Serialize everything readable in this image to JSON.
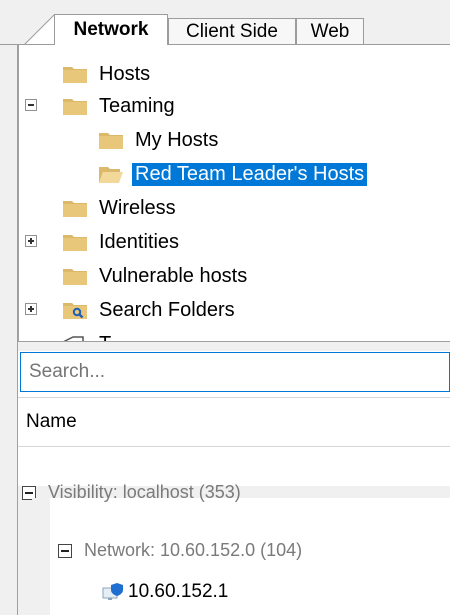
{
  "tabs": [
    {
      "label": "Network",
      "active": true
    },
    {
      "label": "Client Side",
      "active": false
    },
    {
      "label": "Web",
      "active": false
    }
  ],
  "tree": {
    "items": [
      {
        "label": "Hosts",
        "expander": "none",
        "level": 0,
        "icon": "folder-icon"
      },
      {
        "label": "Teaming",
        "expander": "minus",
        "level": 0,
        "icon": "folder-icon"
      },
      {
        "label": "My Hosts",
        "expander": "none",
        "level": 1,
        "icon": "folder-icon"
      },
      {
        "label": "Red Team Leader's Hosts",
        "expander": "none",
        "level": 1,
        "icon": "folder-open-icon",
        "selected": true
      },
      {
        "label": "Wireless",
        "expander": "none",
        "level": 0,
        "icon": "folder-icon"
      },
      {
        "label": "Identities",
        "expander": "plus",
        "level": 0,
        "icon": "folder-icon"
      },
      {
        "label": "Vulnerable hosts",
        "expander": "none",
        "level": 0,
        "icon": "folder-icon"
      },
      {
        "label": "Search Folders",
        "expander": "plus",
        "level": 0,
        "icon": "search-folder-icon"
      },
      {
        "label": "T...",
        "expander": "none",
        "level": 0,
        "icon": "tag-icon"
      }
    ]
  },
  "search": {
    "placeholder": "Search..."
  },
  "grid": {
    "column_header": "Name",
    "group": "Visibility: localhost (353)",
    "subgroup": "Network: 10.60.152.0 (104)",
    "host": "10.60.152.1"
  },
  "colors": {
    "selection": "#0078d7",
    "folder": "#dcb86a",
    "tab_border": "#9c9c9c",
    "group_text": "#7a7a7a"
  }
}
